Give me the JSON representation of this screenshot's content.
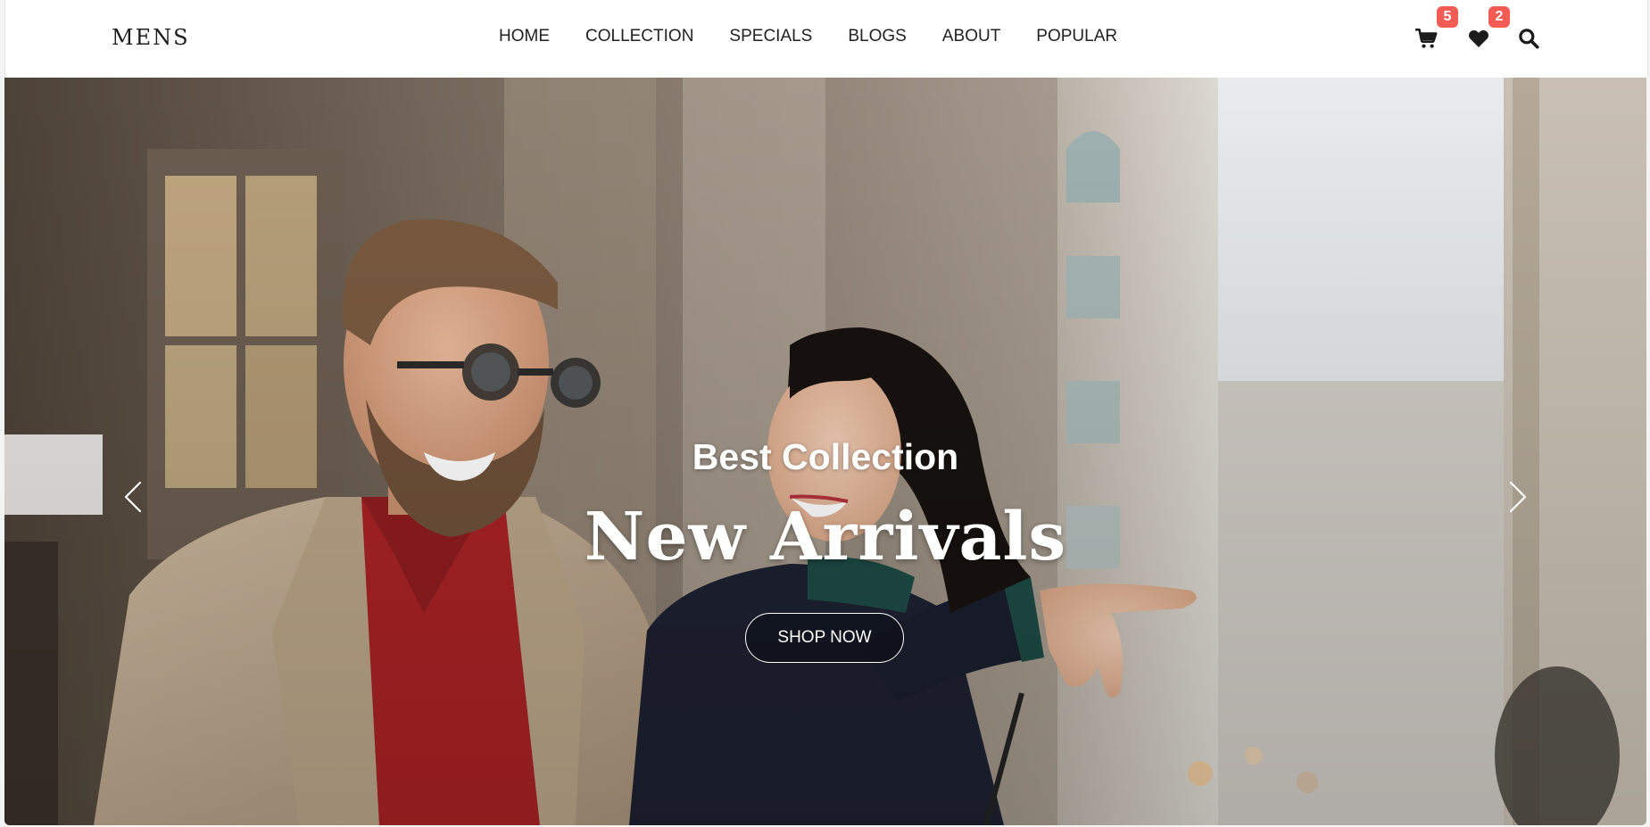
{
  "brand": {
    "name": "MENS"
  },
  "nav": {
    "links": [
      "HOME",
      "COLLECTION",
      "SPECIALS",
      "BLOGS",
      "ABOUT",
      "POPULAR"
    ]
  },
  "header_icons": {
    "cart": {
      "icon": "cart-icon",
      "count": "5"
    },
    "wishlist": {
      "icon": "heart-icon",
      "count": "2"
    },
    "search": {
      "icon": "search-icon"
    }
  },
  "hero": {
    "subtitle": "Best Collection",
    "title": "New Arrivals",
    "cta_label": "SHOP NOW",
    "prev_icon": "chevron-left-icon",
    "next_icon": "chevron-right-icon"
  },
  "colors": {
    "badge": "#f25c54",
    "nav_text": "#222222",
    "hero_text": "#ffffff"
  }
}
